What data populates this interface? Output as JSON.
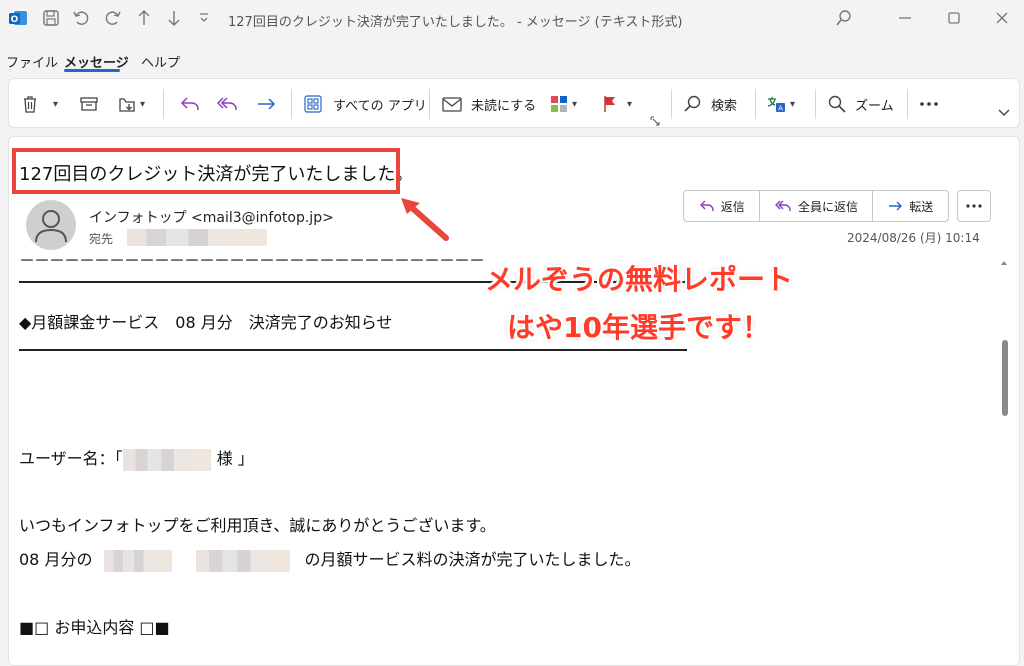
{
  "window": {
    "title": "127回目のクレジット決済が完了いたしました。 - メッセージ (テキスト形式)"
  },
  "menu": {
    "items": [
      "ファイル",
      "メッセージ",
      "ヘルプ"
    ]
  },
  "ribbon": {
    "all_apps": "すべての アプリ",
    "mark_unread": "未読にする",
    "search": "検索",
    "zoom": "ズーム"
  },
  "message": {
    "subject": "127回目のクレジット決済が完了いたしました。",
    "sender": "インフォトップ <mail3@infotop.jp>",
    "to_label": "宛先",
    "date": "2024/08/26 (月) 10:14",
    "reply": "返信",
    "reply_all": "全員に返信",
    "forward": "転送"
  },
  "body": {
    "dashes": "－－－－－－－－－－－－－－－－－－－－－－－－－－－－－－－",
    "heading": "◆月額課金サービス　08 月分　決済完了のお知らせ",
    "user_prefix": "ユーザー名：「",
    "user_suffix": "様 」",
    "line1": "いつもインフォトップをご利用頂き、誠にありがとうございます。",
    "line2_prefix": "08 月分の",
    "line2_suffix": "の月額サービス料の決済が完了いたしました。",
    "section": "■□ お申込内容 □■"
  },
  "annotation": {
    "line1": "メルぞうの無料レポート",
    "line2": "はや10年選手です！"
  },
  "colors": {
    "accent": "#2a66c7",
    "annotation_red": "#ff3b2a",
    "highlight_box": "#e9453b",
    "reply_purple": "#8a3fbf"
  }
}
